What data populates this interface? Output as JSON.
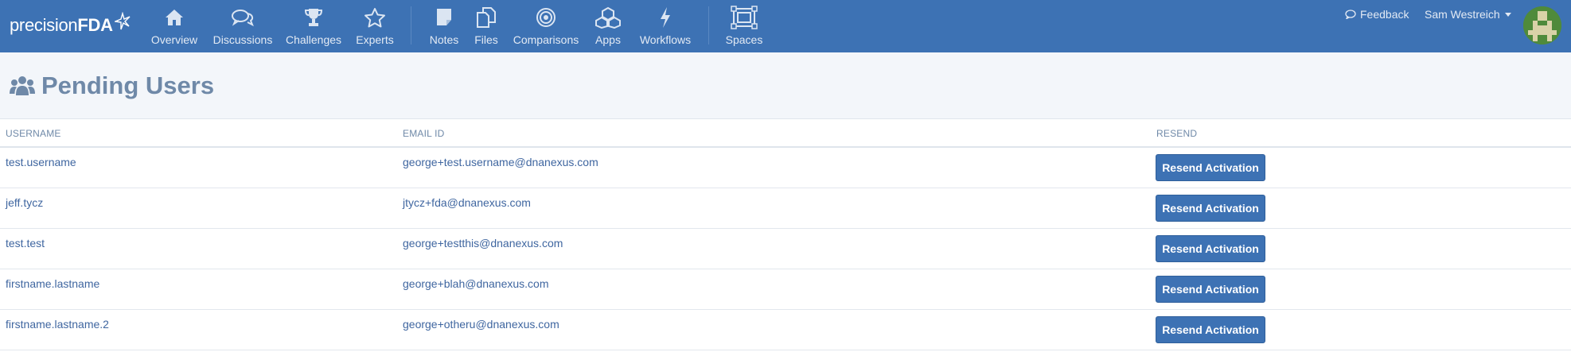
{
  "brand": {
    "light": "precision",
    "bold": "FDA"
  },
  "nav": {
    "items": [
      {
        "label": "Overview"
      },
      {
        "label": "Discussions"
      },
      {
        "label": "Challenges"
      },
      {
        "label": "Experts"
      },
      {
        "label": "Notes"
      },
      {
        "label": "Files"
      },
      {
        "label": "Comparisons"
      },
      {
        "label": "Apps"
      },
      {
        "label": "Workflows"
      },
      {
        "label": "Spaces"
      }
    ],
    "feedback_label": "Feedback",
    "user_name": "Sam Westreich"
  },
  "page": {
    "title": "Pending Users"
  },
  "table": {
    "headers": {
      "username": "USERNAME",
      "email": "EMAIL ID",
      "resend": "RESEND"
    },
    "rows": [
      {
        "username": "test.username",
        "email": "george+test.username@dnanexus.com",
        "button": "Resend Activation"
      },
      {
        "username": "jeff.tycz",
        "email": "jtycz+fda@dnanexus.com",
        "button": "Resend Activation"
      },
      {
        "username": "test.test",
        "email": "george+testthis@dnanexus.com",
        "button": "Resend Activation"
      },
      {
        "username": "firstname.lastname",
        "email": "george+blah@dnanexus.com",
        "button": "Resend Activation"
      },
      {
        "username": "firstname.lastname.2",
        "email": "george+otheru@dnanexus.com",
        "button": "Resend Activation"
      }
    ]
  },
  "colors": {
    "navbar": "#3d72b4",
    "header_bg": "#f3f6fa",
    "link": "#3f66a0",
    "muted": "#6f89a8"
  }
}
